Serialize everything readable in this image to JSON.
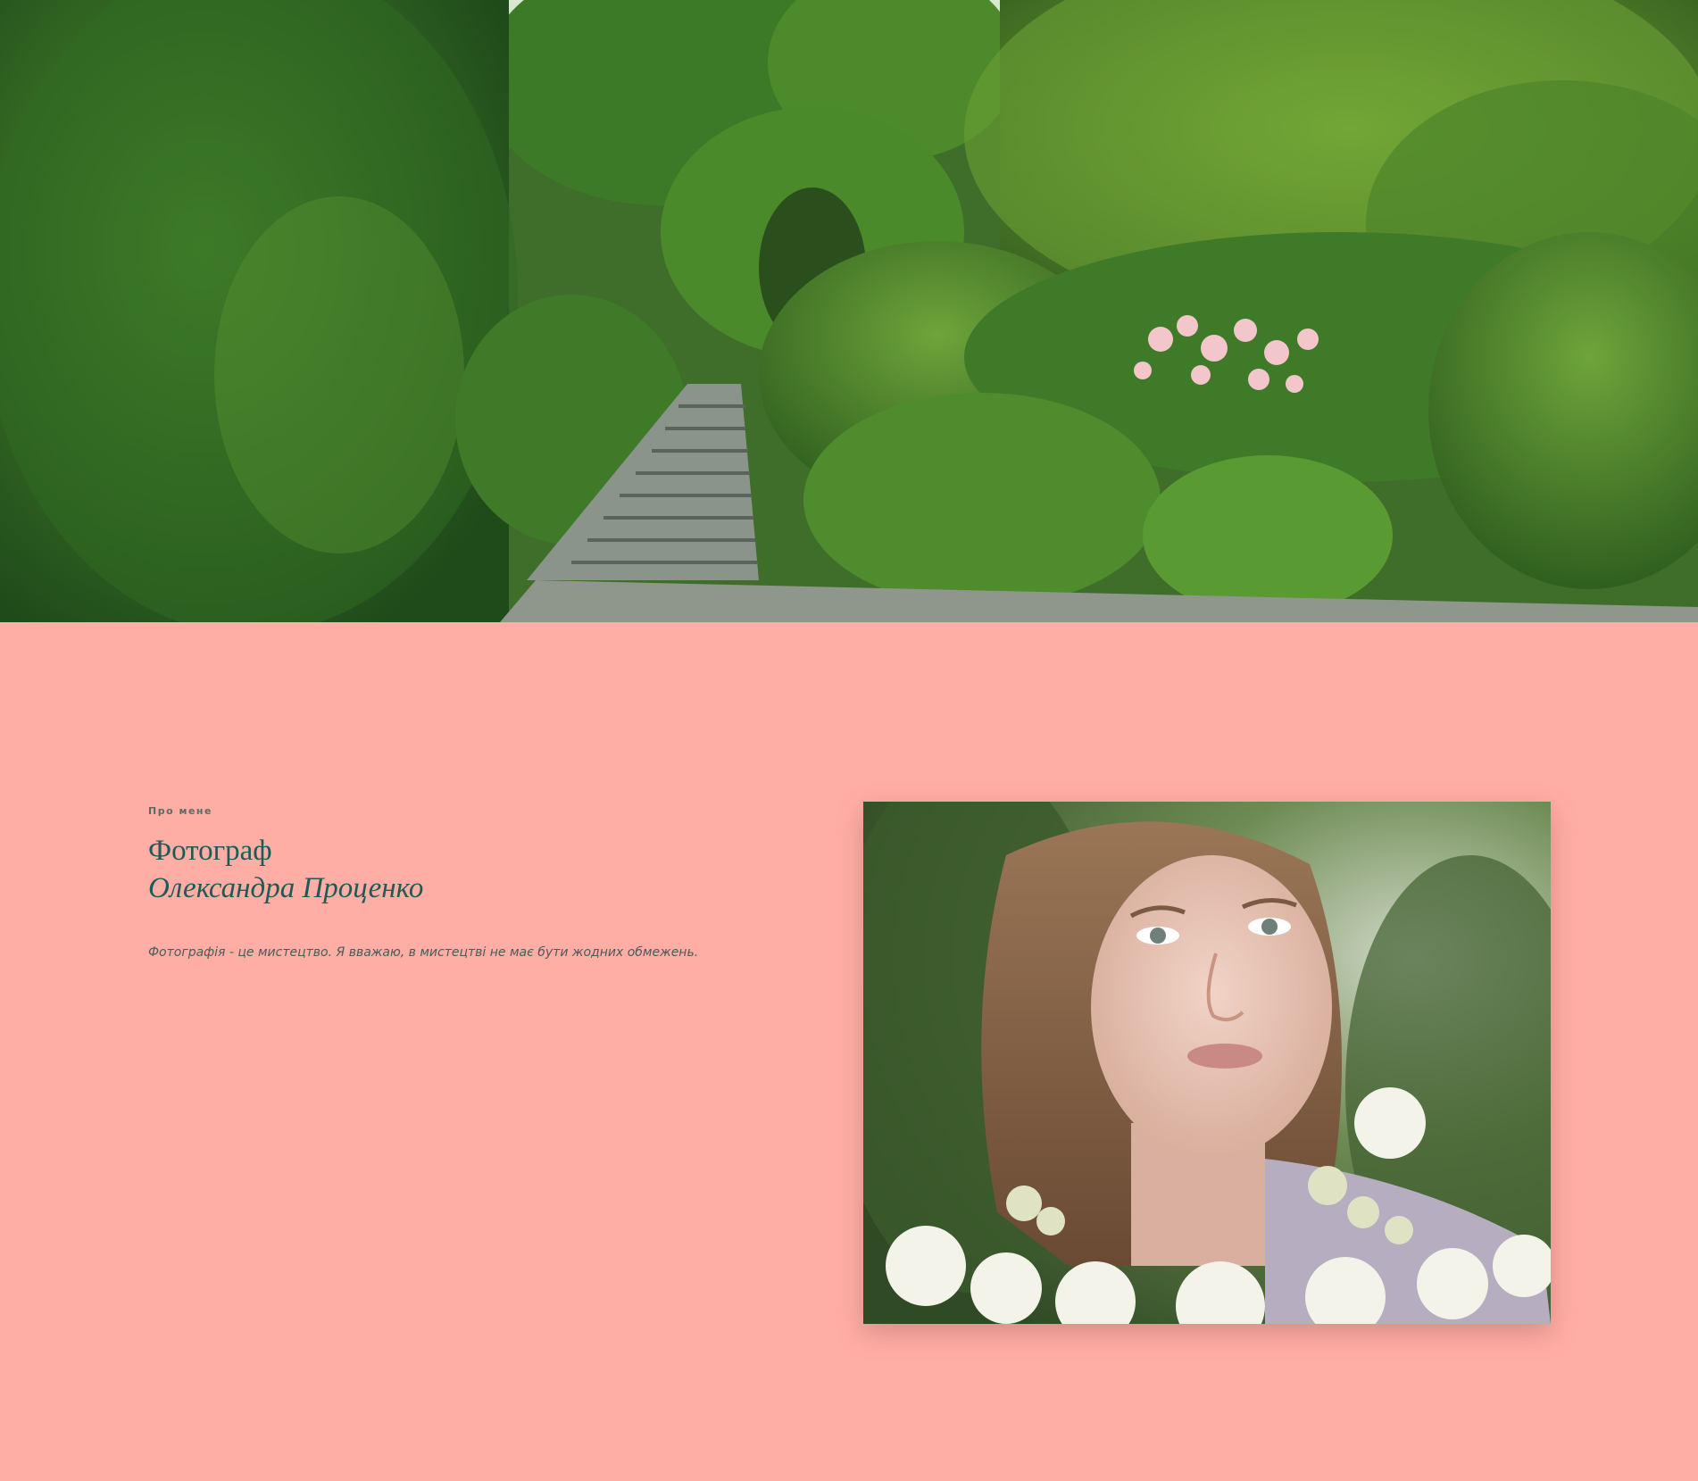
{
  "hero": {
    "image_description_icon": "garden-photo"
  },
  "about": {
    "eyebrow": "Про мене",
    "title_line1": "Фотограф",
    "title_line2": "Олександра Проценко",
    "quote": "Фотографія - це мистецтво. Я вважаю, в мистецтві не має бути жодних обмежень.",
    "portrait_icon": "portrait-photo"
  },
  "colors": {
    "background": "#ffaea6",
    "heading": "#1f5a57",
    "text": "#4c5a58"
  }
}
